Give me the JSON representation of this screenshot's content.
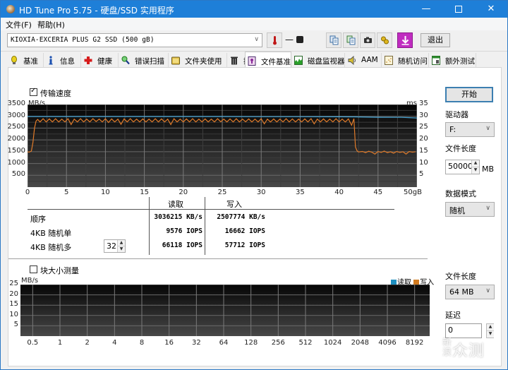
{
  "window": {
    "title": "HD Tune Pro 5.75 - 硬盘/SSD 实用程序",
    "controls": {
      "minimize": "—",
      "close": "✕"
    }
  },
  "menu": [
    "文件(F)",
    "帮助(H)"
  ],
  "toolbar": {
    "drive": "KIOXIA-EXCERIA PLUS G2 SSD (500 gB)",
    "temperature": "—",
    "buttons": [
      "copy-info-icon",
      "copy-info-alt-icon",
      "screenshot-icon",
      "options-icon",
      "save-download-icon"
    ],
    "exit_label": "退出"
  },
  "tabs": [
    {
      "label": "基准",
      "icon": "lightbulb-icon",
      "active": false
    },
    {
      "label": "信息",
      "icon": "info-icon",
      "active": false
    },
    {
      "label": "健康",
      "icon": "health-cross-icon",
      "active": false
    },
    {
      "label": "错误扫描",
      "icon": "magnifier-icon",
      "active": false
    },
    {
      "label": "文件夹使用",
      "icon": "folder-icon",
      "active": false
    },
    {
      "label": "擦除",
      "icon": "trash-icon",
      "active": false
    },
    {
      "label": "文件基准",
      "icon": "file-benchmark-icon",
      "active": true
    },
    {
      "label": "磁盘监视器",
      "icon": "disk-monitor-icon",
      "active": false
    },
    {
      "label": "AAM",
      "icon": "speaker-icon",
      "active": false
    },
    {
      "label": "随机访问",
      "icon": "random-access-icon",
      "active": false
    },
    {
      "label": "额外测试",
      "icon": "extra-tests-icon",
      "active": false
    }
  ],
  "transfer": {
    "checkbox_label": "传输速度",
    "checked": true
  },
  "results": {
    "headers": [
      "读取",
      "写入"
    ],
    "rows": [
      {
        "label": "顺序",
        "read": "3036215 KB/s",
        "write": "2507774 KB/s"
      },
      {
        "label": "4KB 随机单",
        "read": "9576 IOPS",
        "write": "16662 IOPS"
      },
      {
        "label": "4KB 随机多",
        "read": "66118 IOPS",
        "write": "57712 IOPS"
      }
    ],
    "queue_depth": "32"
  },
  "side": {
    "start_label": "开始",
    "drive_label": "驱动器",
    "drive_value": "F:",
    "file_length_label": "文件长度",
    "file_length_value": "50000",
    "file_length_unit": "MB",
    "data_mode_label": "数据模式",
    "data_mode_value": "随机"
  },
  "block": {
    "checkbox_label": "块大小测量",
    "checked": false,
    "file_length_label": "文件长度",
    "file_length_value": "64 MB",
    "delay_label": "延迟",
    "delay_value": "0",
    "legend": [
      {
        "label": "读取",
        "color": "#1e8fc0"
      },
      {
        "label": "写入",
        "color": "#d07a20"
      }
    ]
  },
  "watermark": {
    "small": "新浪",
    "big": "众测"
  },
  "chart_data": [
    {
      "type": "line",
      "title": "传输速度",
      "xlabel": "gB",
      "ylabel": "MB/s",
      "ylabel_right": "ms",
      "xlim": [
        0,
        50
      ],
      "ylim": [
        0,
        3500
      ],
      "ylim_right": [
        0,
        35
      ],
      "x_ticks": [
        "0",
        "5",
        "10",
        "15",
        "20",
        "25",
        "30",
        "35",
        "40",
        "45",
        "50gB"
      ],
      "y_ticks": [
        "500",
        "1000",
        "1500",
        "2000",
        "2500",
        "3000",
        "3500"
      ],
      "y_ticks_right": [
        "5",
        "10",
        "15",
        "20",
        "25",
        "30",
        "35"
      ],
      "grid": true,
      "series": [
        {
          "name": "读取",
          "color": "#4aa8d8",
          "x": [
            0,
            5,
            10,
            15,
            20,
            25,
            30,
            35,
            40,
            42,
            45,
            48,
            49,
            50
          ],
          "y": [
            2990,
            2990,
            2990,
            2990,
            2990,
            2990,
            2985,
            2985,
            2980,
            2975,
            2960,
            2955,
            2945,
            2930
          ]
        },
        {
          "name": "写入",
          "color": "#e07b2a",
          "x": [
            0,
            0.2,
            0.5,
            0.7,
            0.9,
            1.1,
            1.3,
            1.6,
            2,
            2.4,
            2.8,
            3.2,
            3.6,
            4,
            4.4,
            4.8,
            5.2,
            5.6,
            6,
            6.4,
            6.8,
            7.2,
            7.6,
            8,
            8.4,
            8.8,
            9.2,
            9.6,
            10,
            10.4,
            10.8,
            11.2,
            11.6,
            12,
            12.4,
            12.8,
            13.2,
            13.6,
            14,
            14.4,
            14.8,
            15.2,
            15.6,
            16,
            16.4,
            16.8,
            17.2,
            17.6,
            18,
            18.4,
            18.8,
            19.2,
            19.6,
            20,
            20.4,
            20.8,
            21.2,
            21.6,
            22,
            22.4,
            22.8,
            23.2,
            23.6,
            24,
            24.4,
            24.8,
            25.2,
            25.6,
            26,
            26.4,
            26.8,
            27.2,
            27.6,
            28,
            28.4,
            28.8,
            29.2,
            29.6,
            30,
            30.4,
            30.8,
            31.2,
            31.6,
            32,
            32.4,
            32.8,
            33.2,
            33.6,
            34,
            34.4,
            34.8,
            35.2,
            35.6,
            36,
            36.4,
            36.8,
            37.2,
            37.6,
            38,
            38.4,
            38.8,
            39.2,
            39.6,
            40,
            40.4,
            40.8,
            41.2,
            41.6,
            41.9,
            42.1,
            42.3,
            42.5,
            43,
            43.4,
            43.8,
            44.2,
            44.6,
            45,
            45.4,
            45.8,
            46.2,
            46.6,
            47,
            47.4,
            47.8,
            48.2,
            48.6,
            49,
            49.4,
            49.8,
            50
          ],
          "y": [
            1500,
            1480,
            1530,
            1900,
            2500,
            2800,
            2870,
            2760,
            2900,
            2760,
            2890,
            2760,
            2900,
            2760,
            2880,
            2760,
            2900,
            2650,
            2880,
            2760,
            2900,
            2760,
            2880,
            2760,
            2900,
            2780,
            2880,
            2760,
            2900,
            2740,
            2890,
            2760,
            2880,
            2660,
            2890,
            2760,
            2900,
            2760,
            2880,
            2760,
            2890,
            2760,
            2880,
            2760,
            2900,
            2760,
            2890,
            2760,
            2880,
            2650,
            2900,
            2760,
            2880,
            2760,
            2890,
            2760,
            2900,
            2760,
            2880,
            2760,
            2890,
            2760,
            2880,
            2760,
            2900,
            2770,
            2880,
            2760,
            2890,
            2760,
            2900,
            2760,
            2880,
            2770,
            2890,
            2760,
            2880,
            2760,
            2900,
            2680,
            2880,
            2760,
            2890,
            2760,
            2880,
            2760,
            2900,
            2760,
            2890,
            2760,
            2880,
            2760,
            2890,
            2760,
            2900,
            2680,
            2880,
            2760,
            2890,
            2760,
            2880,
            2760,
            2900,
            2760,
            2880,
            2760,
            2890,
            2620,
            2900,
            1700,
            1540,
            1490,
            1510,
            1460,
            1520,
            1480,
            1400,
            1510,
            1470,
            1530,
            1460,
            1500,
            1440,
            1510,
            1470,
            1500,
            1400,
            1510,
            1480,
            1500
          ]
        }
      ]
    },
    {
      "type": "bar",
      "title": "块大小测量",
      "xlabel": "",
      "ylabel": "MB/s",
      "ylim": [
        0,
        25
      ],
      "categories": [
        "0.5",
        "1",
        "2",
        "4",
        "8",
        "16",
        "32",
        "64",
        "128",
        "256",
        "512",
        "1024",
        "2048",
        "4096",
        "8192"
      ],
      "y_ticks": [
        "5",
        "10",
        "15",
        "20",
        "25"
      ],
      "grid": true,
      "legend": "top-right",
      "series": [
        {
          "name": "读取",
          "values": []
        },
        {
          "name": "写入",
          "values": []
        }
      ]
    }
  ]
}
